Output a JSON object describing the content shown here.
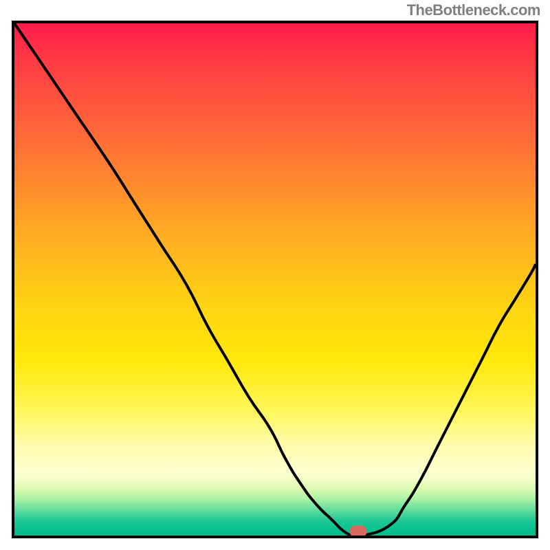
{
  "attribution": "TheBottleneck.com",
  "chart_data": {
    "type": "line",
    "title": "",
    "xlabel": "",
    "ylabel": "",
    "xlim": [
      0,
      100
    ],
    "ylim": [
      0,
      100
    ],
    "x": [
      0,
      6,
      12,
      18,
      23,
      28,
      33,
      37,
      41,
      45,
      49,
      52,
      55,
      58,
      61,
      63,
      65,
      67,
      72,
      75,
      78,
      81,
      84,
      87,
      90,
      93,
      96,
      99,
      100
    ],
    "values": [
      100,
      91,
      82,
      73,
      65,
      57,
      49,
      41,
      34,
      27,
      21,
      15,
      10,
      6,
      3,
      1,
      0,
      0,
      2,
      6,
      11,
      17,
      23,
      29,
      35,
      41,
      46,
      51,
      53
    ],
    "marker": {
      "x": 66,
      "y": 0
    },
    "gradient_stops": [
      {
        "pct": 0,
        "color": "#ff1b4a"
      },
      {
        "pct": 22,
        "color": "#ff6a38"
      },
      {
        "pct": 40,
        "color": "#ffa824"
      },
      {
        "pct": 66,
        "color": "#ffe80a"
      },
      {
        "pct": 87,
        "color": "#fffecd"
      },
      {
        "pct": 93,
        "color": "#a6f0a4"
      },
      {
        "pct": 100,
        "color": "#04bb8b"
      }
    ]
  }
}
